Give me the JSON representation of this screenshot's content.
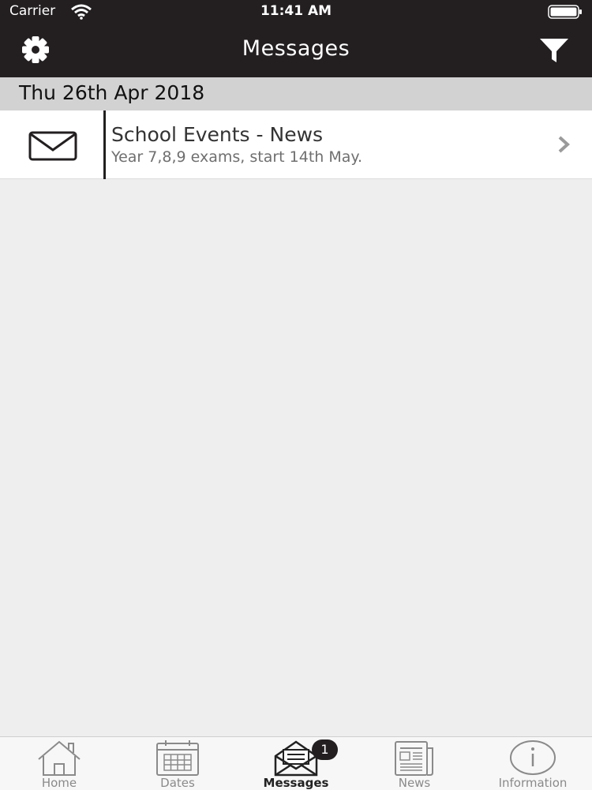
{
  "status_bar": {
    "carrier": "Carrier",
    "time": "11:41 AM",
    "icons": [
      "wifi-icon",
      "battery-icon"
    ]
  },
  "nav_bar": {
    "title": "Messages",
    "left_icon": "gear-icon",
    "right_icon": "filter-icon",
    "background": "#231f20"
  },
  "sections": [
    {
      "date": "Thu 26th Apr 2018",
      "messages": [
        {
          "icon": "envelope-icon",
          "title": "School Events - News",
          "subtitle": "Year 7,8,9 exams, start 14th May."
        }
      ]
    }
  ],
  "tab_bar": {
    "active": "Messages",
    "tabs": [
      {
        "label": "Home",
        "icon": "home-icon"
      },
      {
        "label": "Dates",
        "icon": "calendar-icon"
      },
      {
        "label": "Messages",
        "icon": "envelope-open-icon",
        "badge": "1"
      },
      {
        "label": "News",
        "icon": "newspaper-icon"
      },
      {
        "label": "Information",
        "icon": "info-icon"
      }
    ]
  }
}
